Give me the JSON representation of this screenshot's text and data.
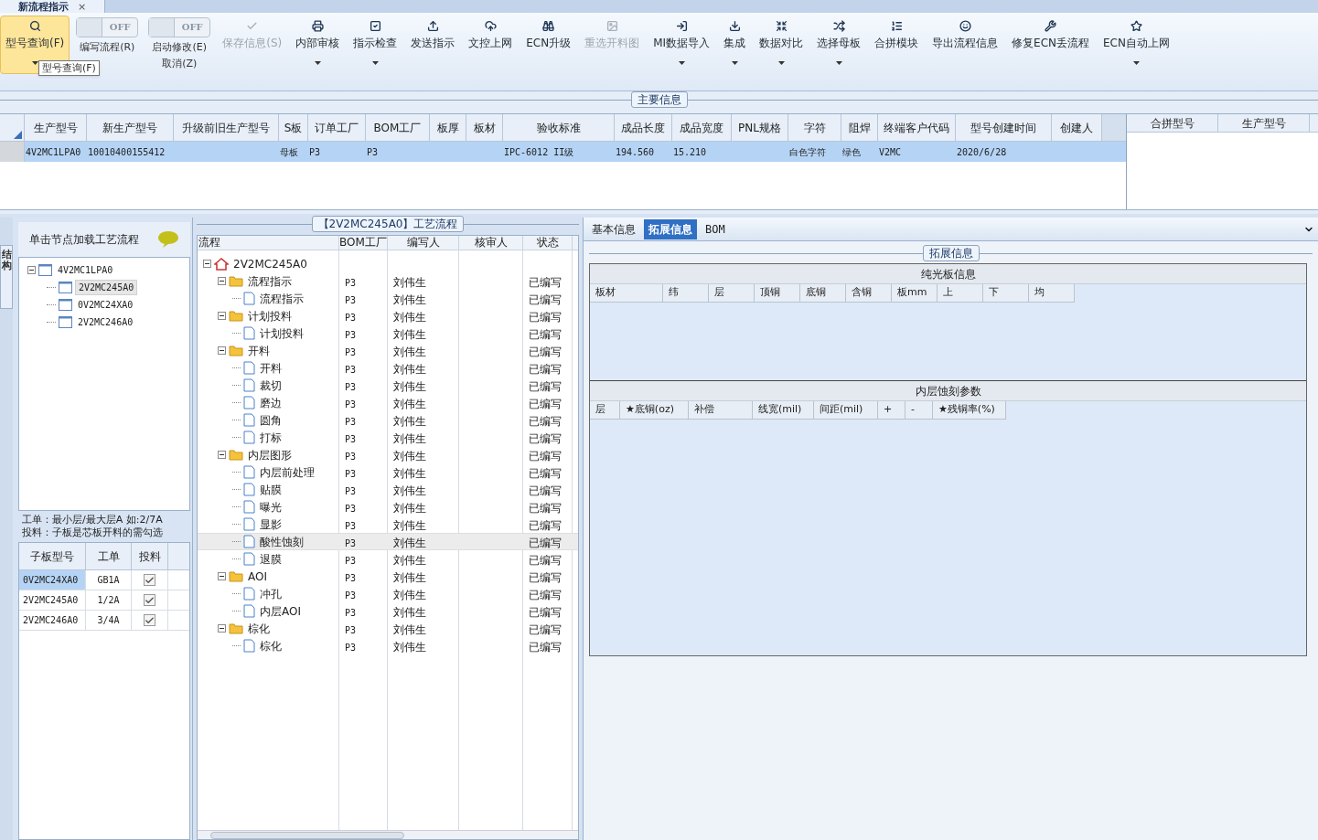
{
  "doc_tab": {
    "title": "新流程指示",
    "close": "×"
  },
  "toolbar": [
    {
      "kind": "button",
      "label": "型号查询(F)",
      "selected": true,
      "disabled": false,
      "dropdown": true,
      "tooltip": "型号查询(F)"
    },
    {
      "kind": "toggle",
      "toggle": "OFF",
      "on": false,
      "lines": [
        "编写流程(R)"
      ]
    },
    {
      "kind": "toggle",
      "toggle": "OFF",
      "on": false,
      "lines": [
        "启动修改(E)",
        "取消(Z)"
      ]
    },
    {
      "kind": "button",
      "label": "保存信息(S)",
      "selected": false,
      "disabled": true,
      "dropdown": false
    },
    {
      "kind": "button",
      "label": "内部审核",
      "selected": false,
      "disabled": false,
      "dropdown": true
    },
    {
      "kind": "button",
      "label": "指示检查",
      "selected": false,
      "disabled": false,
      "dropdown": true
    },
    {
      "kind": "button",
      "label": "发送指示",
      "selected": false,
      "disabled": false,
      "dropdown": false
    },
    {
      "kind": "button",
      "label": "文控上网",
      "selected": false,
      "disabled": false,
      "dropdown": false
    },
    {
      "kind": "button",
      "label": "ECN升级",
      "selected": false,
      "disabled": false,
      "dropdown": false
    },
    {
      "kind": "button",
      "label": "重选开料图",
      "selected": false,
      "disabled": true,
      "dropdown": false
    },
    {
      "kind": "button",
      "label": "MI数据导入",
      "selected": false,
      "disabled": false,
      "dropdown": true
    },
    {
      "kind": "button",
      "label": "集成",
      "selected": false,
      "disabled": false,
      "dropdown": true
    },
    {
      "kind": "button",
      "label": "数据对比",
      "selected": false,
      "disabled": false,
      "dropdown": true
    },
    {
      "kind": "button",
      "label": "选择母板",
      "selected": false,
      "disabled": false,
      "dropdown": true
    },
    {
      "kind": "button",
      "label": "合拼模块",
      "selected": false,
      "disabled": false,
      "dropdown": false
    },
    {
      "kind": "button",
      "label": "导出流程信息",
      "selected": false,
      "disabled": false,
      "dropdown": false
    },
    {
      "kind": "button",
      "label": "修复ECN丢流程",
      "selected": false,
      "disabled": false,
      "dropdown": false
    },
    {
      "kind": "button",
      "label": "ECN自动上网",
      "selected": false,
      "disabled": false,
      "dropdown": true
    }
  ],
  "main_info": {
    "title": "主要信息",
    "columns": [
      "生产型号",
      "新生产型号",
      "升级前旧生产型号",
      "S板",
      "订单工厂",
      "BOM工厂",
      "板厚",
      "板材",
      "验收标准",
      "成品长度",
      "成品宽度",
      "PNL规格",
      "字符",
      "阻焊",
      "终端客户代码",
      "型号创建时间",
      "创建人"
    ],
    "rows": [
      {
        "selected": true,
        "cells": [
          "4V2MC1LPA0",
          "10010400155412",
          "",
          "母板",
          "P3",
          "P3",
          "",
          "",
          "IPC-6012 II级",
          "194.560",
          "15.210",
          "",
          "白色字符",
          "绿色",
          "V2MC",
          "2020/6/28",
          ""
        ]
      }
    ],
    "merge_columns": [
      "合拼型号",
      "生产型号"
    ]
  },
  "left_panel": {
    "side_tab": "结构",
    "header": "单击节点加载工艺流程",
    "tree": [
      {
        "label": "4V2MC1LPA0",
        "selected": false,
        "expanded": true,
        "children": [
          {
            "label": "2V2MC245A0",
            "selected": true
          },
          {
            "label": "0V2MC24XA0",
            "selected": false
          },
          {
            "label": "2V2MC246A0",
            "selected": false
          }
        ]
      }
    ],
    "note": [
      "工单：最小层/最大层A 如:2/7A",
      "投料：子板是芯板开料的需勾选"
    ],
    "sub_columns": [
      "子板型号",
      "工单",
      "投料"
    ],
    "sub_rows": [
      {
        "model": "0V2MC24XA0",
        "order": "GB1A",
        "checked": true,
        "selected": true
      },
      {
        "model": "2V2MC245A0",
        "order": "1/2A",
        "checked": true,
        "selected": false
      },
      {
        "model": "2V2MC246A0",
        "order": "3/4A",
        "checked": true,
        "selected": false
      }
    ]
  },
  "flow": {
    "title": "【2V2MC245A0】工艺流程",
    "columns": [
      "流程",
      "BOM工厂",
      "编写人",
      "核审人",
      "状态"
    ],
    "tree": [
      {
        "kind": "root",
        "label": "2V2MC245A0",
        "expanded": true,
        "selected": false,
        "children": [
          {
            "kind": "folder",
            "label": "流程指示",
            "bom": "P3",
            "author": "刘伟生",
            "status": "已编写",
            "expanded": true,
            "selected": false,
            "children": [
              {
                "kind": "file",
                "label": "流程指示",
                "bom": "P3",
                "author": "刘伟生",
                "status": "已编写",
                "selected": false
              }
            ]
          },
          {
            "kind": "folder",
            "label": "计划投料",
            "bom": "P3",
            "author": "刘伟生",
            "status": "已编写",
            "expanded": true,
            "selected": false,
            "children": [
              {
                "kind": "file",
                "label": "计划投料",
                "bom": "P3",
                "author": "刘伟生",
                "status": "已编写",
                "selected": false
              }
            ]
          },
          {
            "kind": "folder",
            "label": "开料",
            "bom": "P3",
            "author": "刘伟生",
            "status": "已编写",
            "expanded": true,
            "selected": false,
            "children": [
              {
                "kind": "file",
                "label": "开料",
                "bom": "P3",
                "author": "刘伟生",
                "status": "已编写",
                "selected": false
              },
              {
                "kind": "file",
                "label": "裁切",
                "bom": "P3",
                "author": "刘伟生",
                "status": "已编写",
                "selected": false
              },
              {
                "kind": "file",
                "label": "磨边",
                "bom": "P3",
                "author": "刘伟生",
                "status": "已编写",
                "selected": false
              },
              {
                "kind": "file",
                "label": "圆角",
                "bom": "P3",
                "author": "刘伟生",
                "status": "已编写",
                "selected": false
              },
              {
                "kind": "file",
                "label": "打标",
                "bom": "P3",
                "author": "刘伟生",
                "status": "已编写",
                "selected": false
              }
            ]
          },
          {
            "kind": "folder",
            "label": "内层图形",
            "bom": "P3",
            "author": "刘伟生",
            "status": "已编写",
            "expanded": true,
            "selected": false,
            "children": [
              {
                "kind": "file",
                "label": "内层前处理",
                "bom": "P3",
                "author": "刘伟生",
                "status": "已编写",
                "selected": false
              },
              {
                "kind": "file",
                "label": "贴膜",
                "bom": "P3",
                "author": "刘伟生",
                "status": "已编写",
                "selected": false
              },
              {
                "kind": "file",
                "label": "曝光",
                "bom": "P3",
                "author": "刘伟生",
                "status": "已编写",
                "selected": false
              },
              {
                "kind": "file",
                "label": "显影",
                "bom": "P3",
                "author": "刘伟生",
                "status": "已编写",
                "selected": false
              },
              {
                "kind": "file",
                "label": "酸性蚀刻",
                "bom": "P3",
                "author": "刘伟生",
                "status": "已编写",
                "selected": true
              },
              {
                "kind": "file",
                "label": "退膜",
                "bom": "P3",
                "author": "刘伟生",
                "status": "已编写",
                "selected": false
              }
            ]
          },
          {
            "kind": "folder",
            "label": "AOI",
            "bom": "P3",
            "author": "刘伟生",
            "status": "已编写",
            "expanded": true,
            "selected": false,
            "children": [
              {
                "kind": "file",
                "label": "冲孔",
                "bom": "P3",
                "author": "刘伟生",
                "status": "已编写",
                "selected": false
              },
              {
                "kind": "file",
                "label": "内层AOI",
                "bom": "P3",
                "author": "刘伟生",
                "status": "已编写",
                "selected": false
              }
            ]
          },
          {
            "kind": "folder",
            "label": "棕化",
            "bom": "P3",
            "author": "刘伟生",
            "status": "已编写",
            "expanded": true,
            "selected": false,
            "children": [
              {
                "kind": "file",
                "label": "棕化",
                "bom": "P3",
                "author": "刘伟生",
                "status": "已编写",
                "selected": false
              }
            ]
          }
        ]
      }
    ]
  },
  "detail": {
    "tabs": [
      {
        "label": "基本信息",
        "selected": false
      },
      {
        "label": "拓展信息",
        "selected": true
      },
      {
        "label": "BOM",
        "selected": false
      }
    ],
    "group_title": "拓展信息",
    "sections": [
      {
        "title": "纯光板信息",
        "columns": [
          "板材",
          "纬",
          "层",
          "顶铜",
          "底铜",
          "含铜",
          "板mm",
          "上",
          "下",
          "均"
        ]
      },
      {
        "title": "内层蚀刻参数",
        "columns": [
          "层",
          "★底铜(oz)",
          "补偿",
          "线宽(mil)",
          "间距(mil)",
          "+",
          "-",
          "★残铜率(%)"
        ]
      }
    ]
  }
}
